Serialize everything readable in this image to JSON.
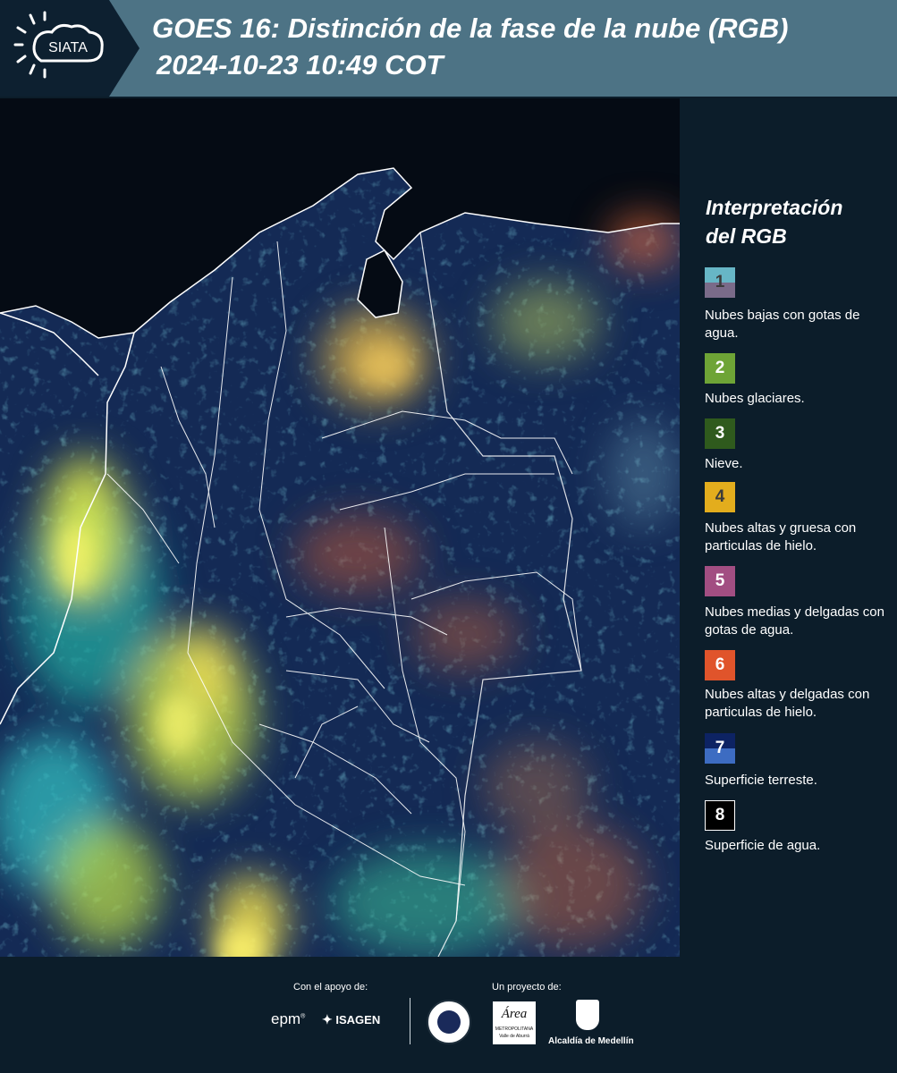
{
  "header": {
    "logo_text": "SIATA",
    "title_line1": "GOES 16: Distinción de la fase de la nube (RGB)",
    "title_line2": "2024-10-23 10:49 COT"
  },
  "legend": {
    "title_line1": "Interpretación",
    "title_line2": "del RGB",
    "items": [
      {
        "number": "1",
        "description": "Nubes bajas con gotas de agua.",
        "colors": [
          "#67b6c6",
          "#7a6b89"
        ]
      },
      {
        "number": "2",
        "description": "Nubes glaciares.",
        "colors": [
          "#6ea436"
        ]
      },
      {
        "number": "3",
        "description": "Nieve.",
        "colors": [
          "#2f5a1d"
        ]
      },
      {
        "number": "4",
        "description": "Nubes altas y gruesa con particulas de hielo.",
        "colors": [
          "#e3ad1d"
        ]
      },
      {
        "number": "5",
        "description": "Nubes medias y delgadas con gotas de agua.",
        "colors": [
          "#a24e82"
        ]
      },
      {
        "number": "6",
        "description": "Nubes altas y delgadas con particulas de hielo.",
        "colors": [
          "#e0542b"
        ]
      },
      {
        "number": "7",
        "description": "Superficie terreste.",
        "colors": [
          "#0d2363",
          "#3d6cc2"
        ]
      },
      {
        "number": "8",
        "description": "Superficie de agua.",
        "colors": [
          "#000000"
        ]
      }
    ]
  },
  "footer": {
    "support_label": "Con el apoyo de:",
    "project_label": "Un proyecto de:",
    "sponsors": {
      "epm": "epm",
      "isagen": "ISAGEN",
      "area": "Área",
      "area_sub1": "METROPOLITANA",
      "area_sub2": "Valle de Aburrá",
      "alcaldia": "Alcaldía de Medellín"
    }
  },
  "colors": {
    "header_bg": "#4d7385",
    "panel_bg": "#0c1d2a",
    "ocean": "#050b14",
    "land": "#142a55"
  }
}
